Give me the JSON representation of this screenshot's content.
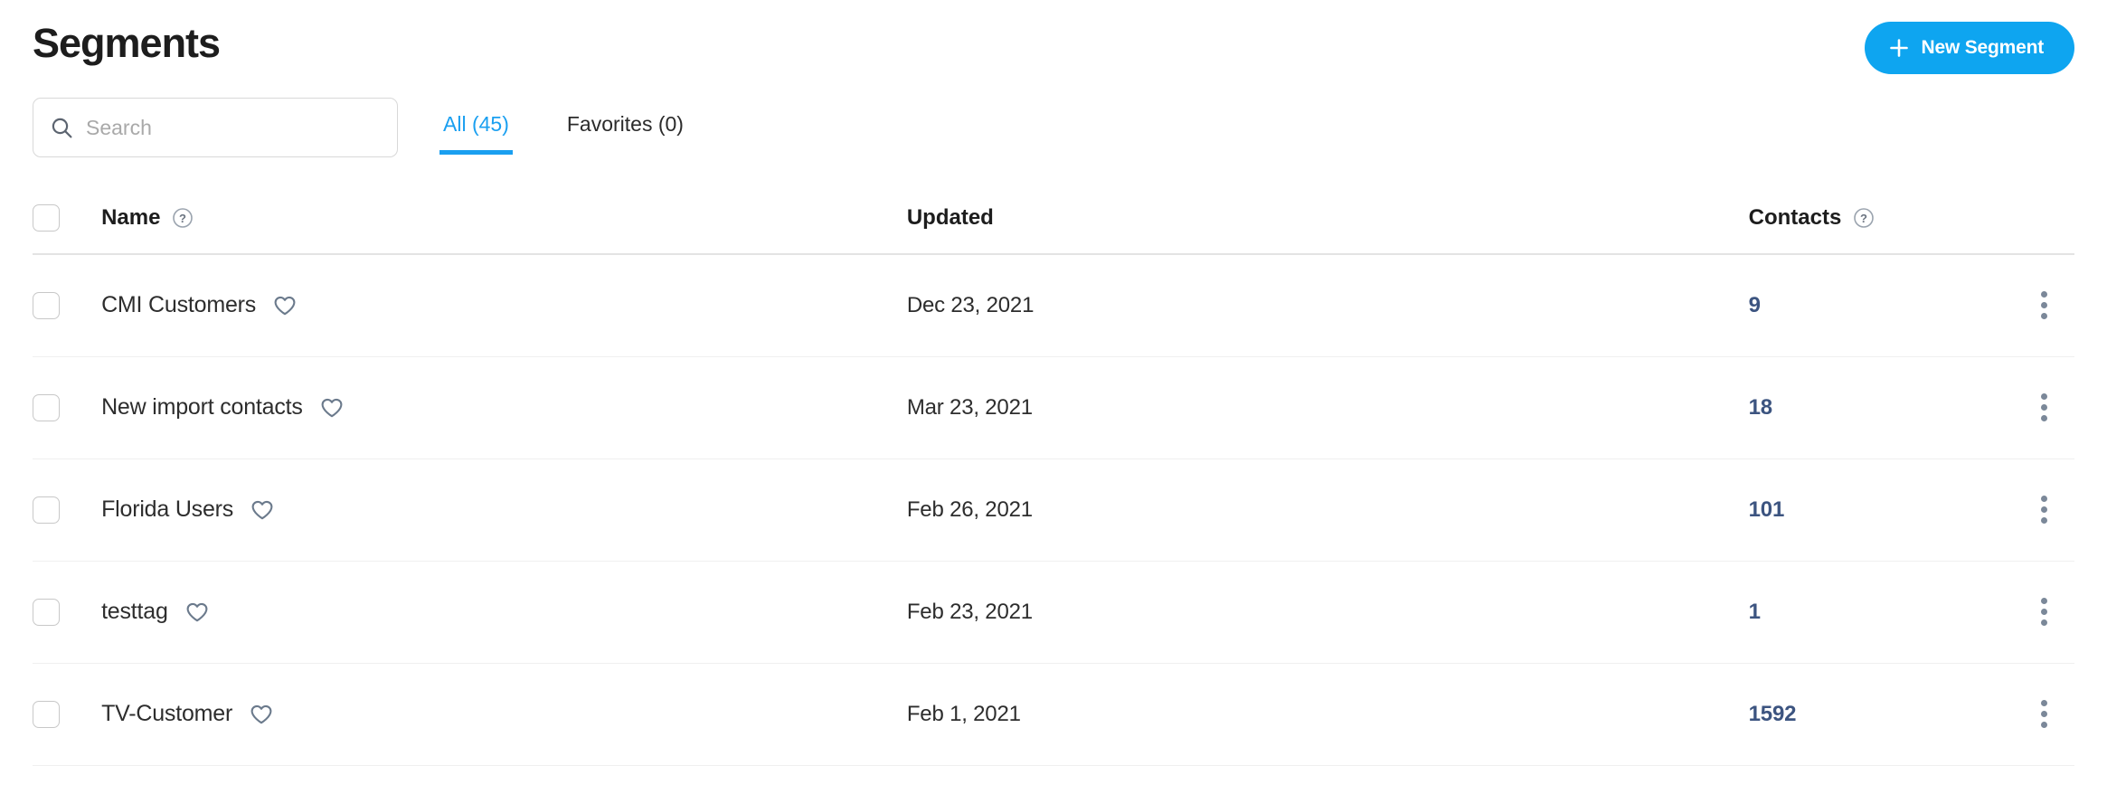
{
  "header": {
    "title": "Segments",
    "new_segment_label": "New Segment",
    "plus_icon": "plus-icon",
    "accent_color": "#0ea5f0"
  },
  "toolbar": {
    "search_placeholder": "Search",
    "search_value": "",
    "search_icon": "search-icon",
    "tabs": [
      {
        "label": "All (45)",
        "active": true
      },
      {
        "label": "Favorites (0)",
        "active": false
      }
    ]
  },
  "table": {
    "columns": {
      "name": "Name",
      "updated": "Updated",
      "contacts": "Contacts"
    },
    "help_icon": "question-mark-circle-icon",
    "favorite_icon": "heart-icon",
    "menu_icon": "kebab-menu-icon",
    "contacts_color": "#3c5480",
    "rows": [
      {
        "name": "CMI Customers",
        "updated": "Dec 23, 2021",
        "contacts": "9"
      },
      {
        "name": "New import contacts",
        "updated": "Mar 23, 2021",
        "contacts": "18"
      },
      {
        "name": "Florida Users",
        "updated": "Feb 26, 2021",
        "contacts": "101"
      },
      {
        "name": "testtag",
        "updated": "Feb 23, 2021",
        "contacts": "1"
      },
      {
        "name": "TV-Customer",
        "updated": "Feb 1, 2021",
        "contacts": "1592"
      }
    ]
  }
}
